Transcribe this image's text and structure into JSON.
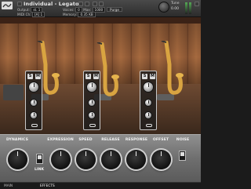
{
  "header": {
    "instrument_name": "Individual - Legato",
    "output_label": "Output:",
    "output_value": "st. 1",
    "midi_label": "MIDI Ch:",
    "midi_value": "[A] 1",
    "voices_label": "Voices:",
    "voices_value": "0",
    "max_label": "Max:",
    "max_value": "1000",
    "memory_label": "Memory:",
    "memory_value": "0.35 KB",
    "purge_label": "Purge",
    "tune_label": "Tune",
    "tune_value": "0.00"
  },
  "mixer": {
    "s_label": "S",
    "m_label": "M"
  },
  "controls": {
    "labels": [
      "DYNAMICS",
      "EXPRESSION",
      "SPEED",
      "RELEASE",
      "RESPONSE",
      "OFFSET",
      "NOISE"
    ],
    "link_label": "LINK"
  },
  "footer": {
    "tabs": [
      "MAIN",
      "EFFECTS"
    ]
  },
  "colors": {
    "panel_bg": "#6f6f6f",
    "wood": "#8a5634",
    "header": "#2c2c2c"
  }
}
